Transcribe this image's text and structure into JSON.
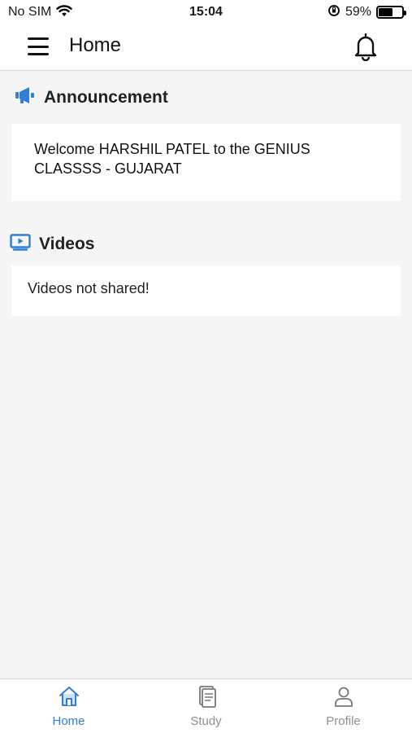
{
  "status_bar": {
    "carrier": "No SIM",
    "time": "15:04",
    "battery_percent": "59%",
    "battery_level": 0.59
  },
  "header": {
    "title": "Home"
  },
  "announcement": {
    "title": "Announcement",
    "message": "Welcome HARSHIL PATEL to the GENIUS CLASSSS - GUJARAT"
  },
  "videos": {
    "title": "Videos",
    "empty_message": "Videos not shared!"
  },
  "tabs": [
    {
      "label": "Home",
      "icon": "home-icon",
      "active": true
    },
    {
      "label": "Study",
      "icon": "document-icon",
      "active": false
    },
    {
      "label": "Profile",
      "icon": "user-icon",
      "active": false
    }
  ],
  "colors": {
    "accent": "#2f7fd6",
    "inactive": "#8f8f8f",
    "background": "#f5f5f5"
  }
}
